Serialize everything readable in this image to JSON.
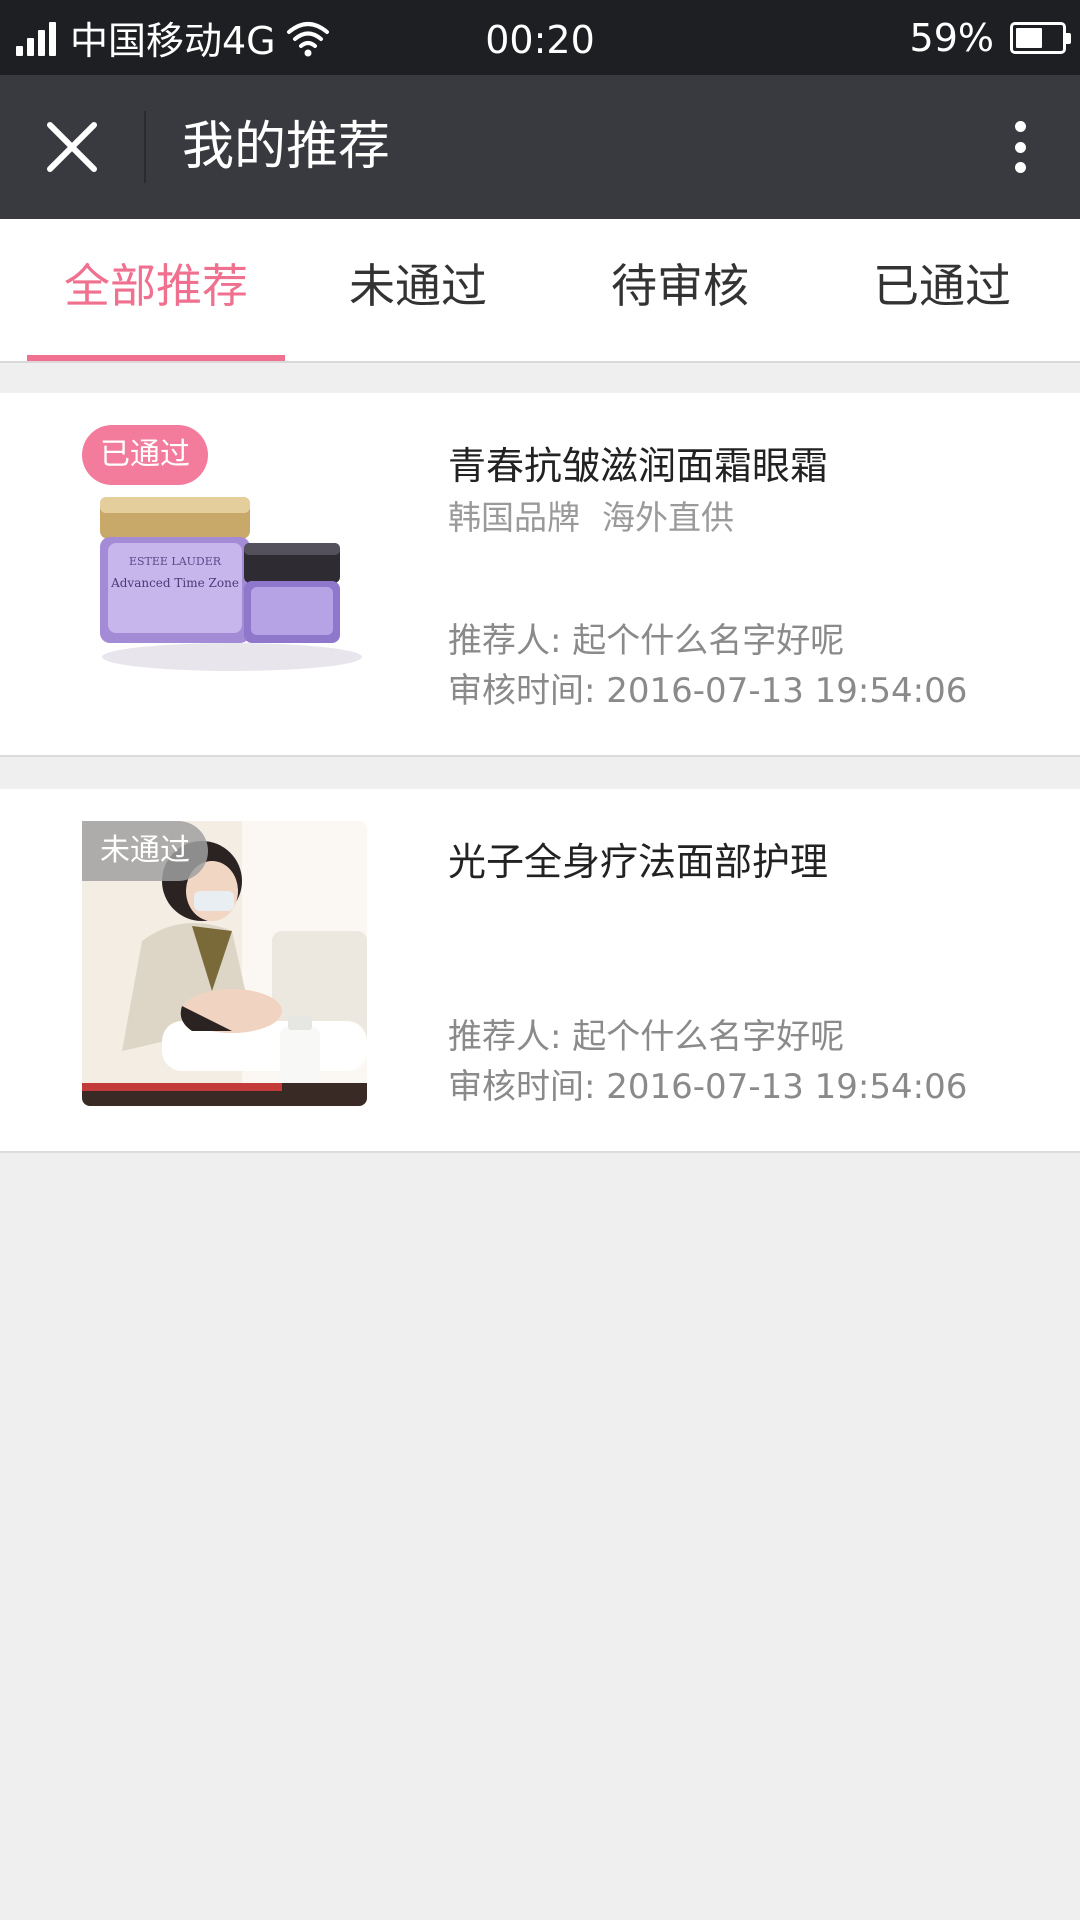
{
  "status_bar": {
    "carrier": "中国移动4G",
    "time": "00:20",
    "battery": "59%",
    "battery_level": 0.59
  },
  "nav": {
    "title": "我的推荐"
  },
  "tabs": [
    {
      "label": "全部推荐",
      "active": true
    },
    {
      "label": "未通过",
      "active": false
    },
    {
      "label": "待审核",
      "active": false
    },
    {
      "label": "已通过",
      "active": false
    }
  ],
  "items": [
    {
      "badge": "已通过",
      "title": "青春抗皱滋润面霜眼霜",
      "tags": [
        "韩国品牌",
        "海外直供"
      ],
      "referrer": "推荐人: 起个什么名字好呢",
      "review_time": "审核时间: 2016-07-13  19:54:06",
      "image_text_1": "ESTEE LAUDER",
      "image_text_2": "Advanced Time Zone"
    },
    {
      "badge": "未通过",
      "title": "光子全身疗法面部护理",
      "tags": [],
      "referrer": "推荐人: 起个什么名字好呢",
      "review_time": "审核时间: 2016-07-13  19:54:06"
    }
  ],
  "colors": {
    "accent": "#f0708f",
    "pass_badge": "#f37c9c",
    "fail_badge": "#a0a0a0",
    "nav_bg": "#393a3f",
    "status_bg": "#1e1f22"
  }
}
